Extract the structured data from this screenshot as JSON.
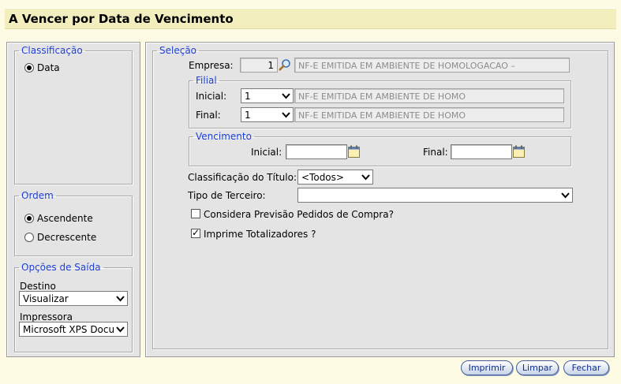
{
  "page": {
    "title": "A Vencer por Data de Vencimento"
  },
  "classificacao": {
    "legend": "Classificação",
    "options": [
      {
        "label": "Data",
        "selected": true
      }
    ]
  },
  "ordem": {
    "legend": "Ordem",
    "options": [
      {
        "label": "Ascendente",
        "selected": true
      },
      {
        "label": "Decrescente",
        "selected": false
      }
    ]
  },
  "saida": {
    "legend": "Opções de Saída",
    "destino_label": "Destino",
    "destino_value": "Visualizar",
    "impressora_label": "Impressora",
    "impressora_value": "Microsoft XPS Docu"
  },
  "selecao": {
    "legend": "Seleção",
    "empresa": {
      "label": "Empresa:",
      "code": "1",
      "description": "NF-E EMITIDA EM AMBIENTE DE HOMOLOGACAO –"
    },
    "filial": {
      "legend": "Filial",
      "inicial_label": "Inicial:",
      "inicial_value": "1",
      "inicial_desc": "NF-E EMITIDA EM AMBIENTE DE HOMO",
      "final_label": "Final:",
      "final_value": "1",
      "final_desc": "NF-E EMITIDA EM AMBIENTE DE HOMO"
    },
    "vencimento": {
      "legend": "Vencimento",
      "inicial_label": "Inicial:",
      "inicial_value": "",
      "final_label": "Final:",
      "final_value": ""
    },
    "classificacao_titulo": {
      "label": "Classificação do Título:",
      "value": "<Todos>"
    },
    "tipo_terceiro": {
      "label": "Tipo de Terceiro:",
      "value": ""
    },
    "considera_previsao": {
      "label": "Considera Previsão Pedidos de Compra?",
      "checked": false
    },
    "imprime_totalizadores": {
      "label": "Imprime Totalizadores ?",
      "checked": true
    }
  },
  "buttons": {
    "imprimir": "Imprimir",
    "limpar": "Limpar",
    "fechar": "Fechar"
  }
}
